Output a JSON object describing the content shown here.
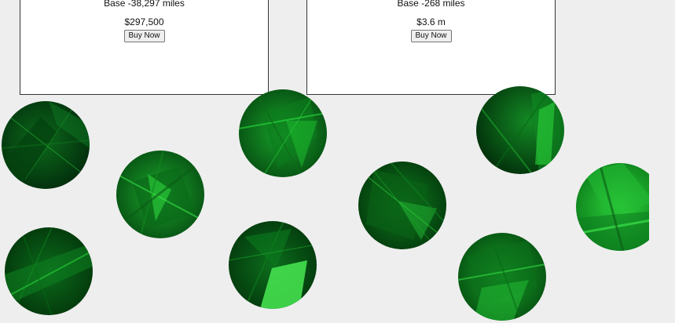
{
  "listings": [
    {
      "mileage": "Base -38,297 miles",
      "price": "$297,500",
      "buy_label": "Buy Now"
    },
    {
      "mileage": "Base -268 miles",
      "price": "$3.6 m",
      "buy_label": "Buy Now"
    }
  ],
  "decorations": {
    "icon": "green-crystal-orb",
    "count": 9,
    "colors": [
      "#003b0a",
      "#0b7a1e",
      "#2fd13a"
    ]
  }
}
